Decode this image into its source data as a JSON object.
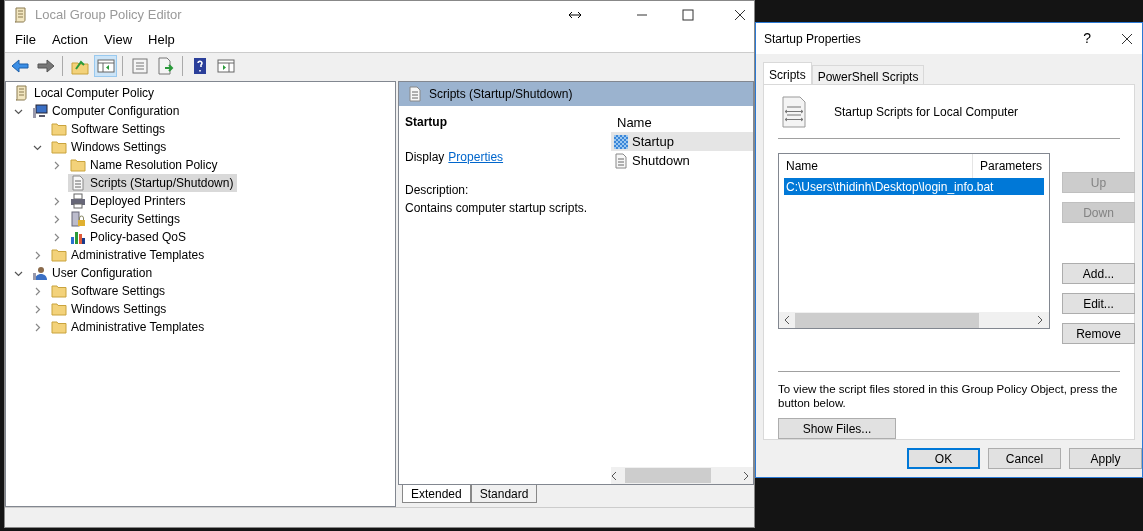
{
  "main_window": {
    "title": "Local Group Policy Editor",
    "menu": [
      "File",
      "Action",
      "View",
      "Help"
    ],
    "toolbar": [
      {
        "kind": "back",
        "selected": false
      },
      {
        "kind": "forward",
        "selected": false
      },
      {
        "kind": "sep"
      },
      {
        "kind": "up",
        "selected": false
      },
      {
        "kind": "tree",
        "selected": true
      },
      {
        "kind": "sep"
      },
      {
        "kind": "properties",
        "selected": false
      },
      {
        "kind": "export",
        "selected": false
      },
      {
        "kind": "sep"
      },
      {
        "kind": "help",
        "selected": false
      },
      {
        "kind": "view",
        "selected": false
      }
    ],
    "tree": [
      {
        "label": "Local Computer Policy",
        "kind": "policy",
        "selected": false,
        "children": [
          {
            "label": "Computer Configuration",
            "kind": "computer",
            "expanded": true,
            "selected": false,
            "children": [
              {
                "label": "Software Settings",
                "kind": "folder",
                "selected": false
              },
              {
                "label": "Windows Settings",
                "kind": "folder",
                "expanded": true,
                "selected": false,
                "children": [
                  {
                    "label": "Name Resolution Policy",
                    "kind": "folder",
                    "expanded": false,
                    "selected": false
                  },
                  {
                    "label": "Scripts (Startup/Shutdown)",
                    "kind": "script",
                    "selected": true
                  },
                  {
                    "label": "Deployed Printers",
                    "kind": "printer",
                    "expanded": false,
                    "selected": false
                  },
                  {
                    "label": "Security Settings",
                    "kind": "security",
                    "expanded": false,
                    "selected": false
                  },
                  {
                    "label": "Policy-based QoS",
                    "kind": "chart",
                    "expanded": false,
                    "selected": false
                  }
                ]
              },
              {
                "label": "Administrative Templates",
                "kind": "folder",
                "expanded": false,
                "selected": false
              }
            ]
          },
          {
            "label": "User Configuration",
            "kind": "user",
            "expanded": true,
            "selected": false,
            "children": [
              {
                "label": "Software Settings",
                "kind": "folder",
                "expanded": false,
                "selected": false
              },
              {
                "label": "Windows Settings",
                "kind": "folder",
                "expanded": false,
                "selected": false
              },
              {
                "label": "Administrative Templates",
                "kind": "folder",
                "expanded": false,
                "selected": false
              }
            ]
          }
        ]
      }
    ],
    "detail": {
      "header": "Scripts (Startup/Shutdown)",
      "heading": "Startup",
      "display_label": "Display",
      "link": "Properties",
      "description_label": "Description:",
      "description": "Contains computer startup scripts.",
      "list_column": "Name",
      "items": [
        {
          "label": "Startup",
          "kind": "startup",
          "selected": true
        },
        {
          "label": "Shutdown",
          "kind": "script",
          "selected": false
        }
      ],
      "tabs": [
        {
          "label": "Extended",
          "selected": true
        },
        {
          "label": "Standard",
          "selected": false
        }
      ]
    }
  },
  "dialog": {
    "title": "Startup Properties",
    "help_glyph": "?",
    "tabs": [
      {
        "label": "Scripts",
        "selected": true
      },
      {
        "label": "PowerShell Scripts",
        "selected": false
      }
    ],
    "heading": "Startup Scripts for Local Computer",
    "columns": [
      "Name",
      "Parameters"
    ],
    "rows": [
      {
        "name": "C:\\Users\\thidinh\\Desktop\\login_info.bat",
        "selected": true
      }
    ],
    "side_buttons": [
      {
        "label": "Up",
        "disabled": true
      },
      {
        "label": "Down",
        "disabled": true
      },
      {
        "label": "Add...",
        "disabled": false
      },
      {
        "label": "Edit...",
        "disabled": false
      },
      {
        "label": "Remove",
        "disabled": false
      }
    ],
    "note": "To view the script files stored in this Group Policy Object, press the button below.",
    "show_files": "Show Files...",
    "footer_buttons": [
      {
        "label": "OK",
        "default": true
      },
      {
        "label": "Cancel",
        "default": false
      },
      {
        "label": "Apply",
        "default": false
      }
    ]
  }
}
